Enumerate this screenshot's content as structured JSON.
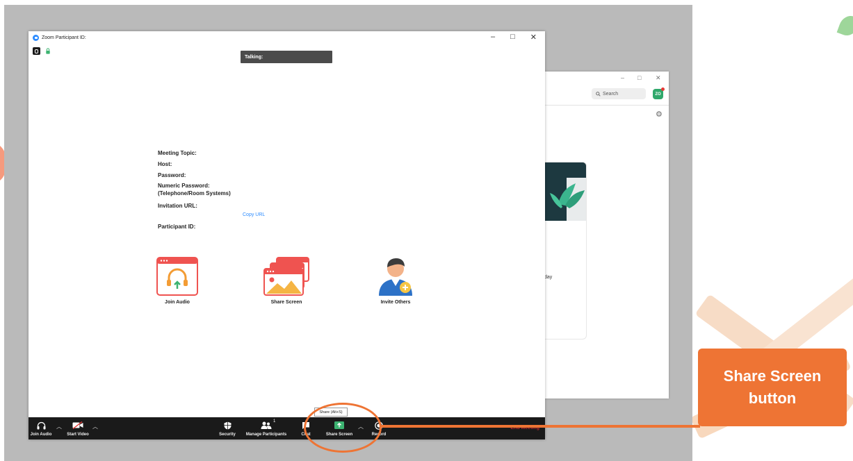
{
  "background_window": {
    "search_placeholder": "Search",
    "avatar_initials": "ZO",
    "card_text": "day"
  },
  "main_window": {
    "title": "Zoom Participant ID:",
    "talking_label": "Talking:",
    "meeting_info": {
      "meeting_topic": "Meeting Topic:",
      "host": "Host:",
      "password": "Password:",
      "numeric_password_1": "Numeric Password:",
      "numeric_password_2": "(Telephone/Room Systems)",
      "invitation_url": "Invitation URL:",
      "copy_url": "Copy URL",
      "participant_id": "Participant ID:"
    },
    "actions": [
      {
        "label": "Join Audio",
        "icon": "headphones-icon"
      },
      {
        "label": "Share Screen",
        "icon": "share-screen-icon"
      },
      {
        "label": "Invite Others",
        "icon": "invite-person-icon"
      }
    ]
  },
  "toolbar": {
    "join_audio": "Join Audio",
    "start_video": "Start Video",
    "security": "Security",
    "manage_participants": "Manage Participants",
    "participant_count": "1",
    "chat": "Chat",
    "share_screen": "Share Screen",
    "record": "Record",
    "end_meeting": "End Meeting",
    "share_tooltip": "Share (Alt+S)"
  },
  "callout": {
    "line1": "Share Screen",
    "line2": "button"
  },
  "colors": {
    "accent_orange": "#ee7434",
    "zoom_blue": "#2d8cff",
    "share_green": "#3cb371",
    "toolbar_bg": "#1a1a1a"
  }
}
